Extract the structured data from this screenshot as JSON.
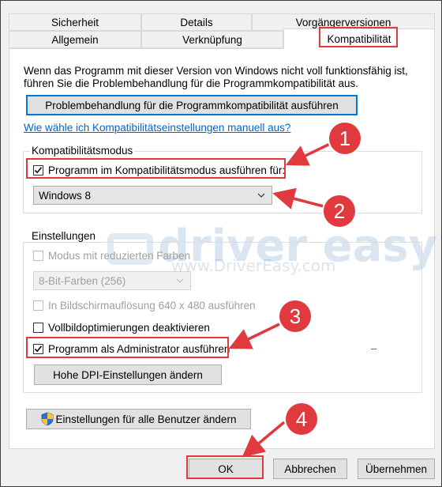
{
  "tabs_row1": [
    {
      "label": "Sicherheit"
    },
    {
      "label": "Details"
    },
    {
      "label": "Vorgängerversionen"
    }
  ],
  "tabs_row2": [
    {
      "label": "Allgemein"
    },
    {
      "label": "Verknüpfung"
    },
    {
      "label": "Kompatibilität"
    }
  ],
  "intro_text_line1": "Wenn das Programm mit dieser Version von Windows nicht voll funktionsfähig ist,",
  "intro_text_line2": "führen Sie die Problembehandlung für die Programmkompatibilität aus.",
  "troubleshoot_button": "Problembehandlung für die Programmkompatibilität ausführen",
  "manual_link": "Wie wähle ich Kompatibilitätseinstellungen manuell aus?",
  "compat_group": {
    "legend": "Kompatibilitätsmodus",
    "checkbox_label": "Programm im Kompatibilitätsmodus ausführen für:",
    "checked": true,
    "select_value": "Windows 8"
  },
  "settings_group": {
    "legend": "Einstellungen",
    "reduced_colors_label": "Modus mit reduzierten Farben",
    "color_select_value": "8-Bit-Farben (256)",
    "resolution_label": "In Bildschirmauflösung 640 x 480 ausführen",
    "fullscreen_opt_label": "Vollbildoptimierungen deaktivieren",
    "admin_label": "Programm als Administrator ausführen",
    "admin_checked": true,
    "dpi_button": "Hohe DPI-Einstellungen ändern"
  },
  "all_users_button": "Einstellungen für alle Benutzer ändern",
  "footer": {
    "ok": "OK",
    "cancel": "Abbrechen",
    "apply": "Übernehmen"
  },
  "badges": [
    "1",
    "2",
    "3",
    "4"
  ],
  "watermark": {
    "logo_text": "driver easy",
    "url_text": "www.DriverEasy.com"
  },
  "colors": {
    "annotation_red": "#e0393e",
    "link_blue": "#0066cc",
    "focus_blue": "#0078d7"
  }
}
